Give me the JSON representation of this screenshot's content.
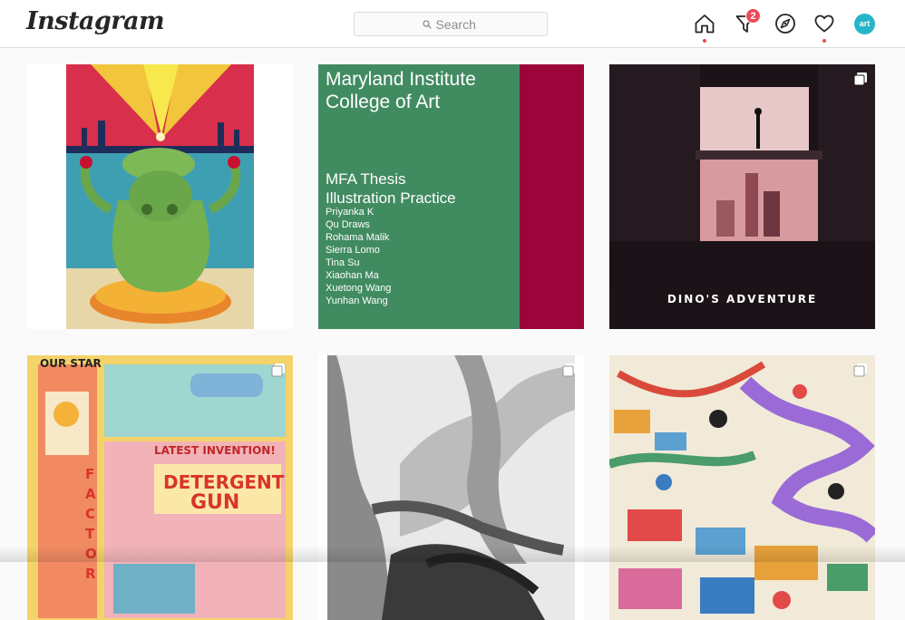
{
  "header": {
    "logo_text": "Instagram",
    "search_placeholder": "Search",
    "direct_badge": "2",
    "avatar_text": "art"
  },
  "colors": {
    "notification": "#ed4956",
    "mica_green": "#418b61",
    "mica_crimson": "#9b0539",
    "avatar": "#26b5c8"
  },
  "posts": [
    {
      "id": "post-1",
      "art": "yellow-green-goddess-illustration",
      "multi": false
    },
    {
      "id": "post-2",
      "art": "mica-thesis-card",
      "multi": false,
      "school_line1": "Maryland Institute",
      "school_line2": "College of Art",
      "thesis_line1": "MFA Thesis",
      "thesis_line2": "Illustration Practice",
      "names": [
        "Priyanka K",
        "Qu Draws",
        "Rohama Malik",
        "Sierra Lomo",
        "Tina Su",
        "Xiaohan Ma",
        "Xuetong Wang",
        "Yunhan Wang"
      ]
    },
    {
      "id": "post-3",
      "art": "dinos-adventure-cover",
      "multi": true,
      "caption": "DINO'S ADVENTURE"
    },
    {
      "id": "post-4",
      "art": "detergent-gun-comic",
      "multi": true,
      "text_top": "OUR STAR",
      "text_mid": "LATEST INVENTION!",
      "text_main1": "DETERGENT",
      "text_main2": "GUN",
      "text_side": "FACTOR"
    },
    {
      "id": "post-5",
      "art": "grayscale-tree-drawing",
      "multi": true
    },
    {
      "id": "post-6",
      "art": "crowded-market-illustration",
      "multi": true
    }
  ]
}
